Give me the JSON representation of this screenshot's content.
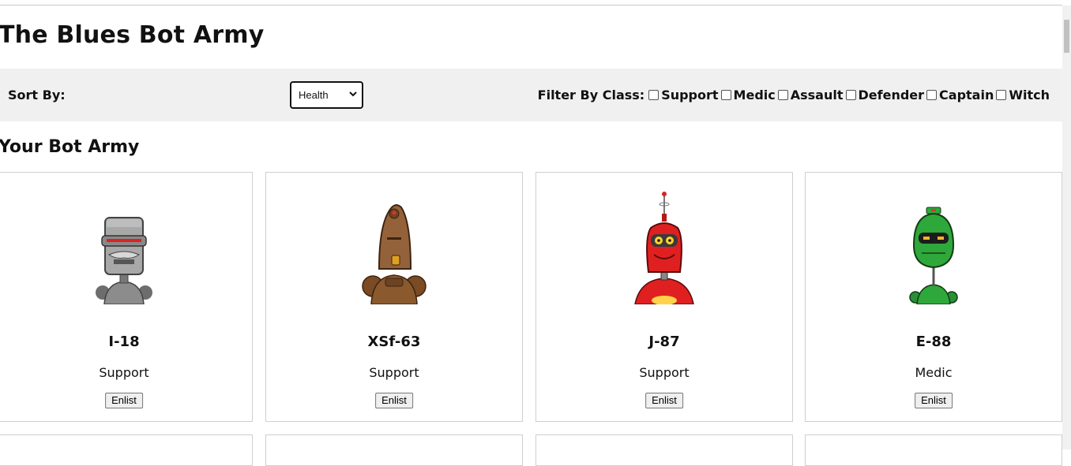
{
  "header": {
    "title": "The Blues Bot Army"
  },
  "toolbar": {
    "sort_label": "Sort By:",
    "sort_selected": "Health",
    "filter_label": "Filter By Class:",
    "filter_options": [
      "Support",
      "Medic",
      "Assault",
      "Defender",
      "Captain",
      "Witch"
    ]
  },
  "section": {
    "title": "Your Bot Army"
  },
  "bots": [
    {
      "name": "I-18",
      "class": "Support",
      "avatar": "gray-robot-icon",
      "color": "#9a9a9a",
      "button": "Enlist"
    },
    {
      "name": "XSf-63",
      "class": "Support",
      "avatar": "brown-robot-icon",
      "color": "#8a5a2e",
      "button": "Enlist"
    },
    {
      "name": "J-87",
      "class": "Support",
      "avatar": "red-robot-icon",
      "color": "#e02020",
      "button": "Enlist"
    },
    {
      "name": "E-88",
      "class": "Medic",
      "avatar": "green-robot-icon",
      "color": "#2ea83a",
      "button": "Enlist"
    }
  ]
}
